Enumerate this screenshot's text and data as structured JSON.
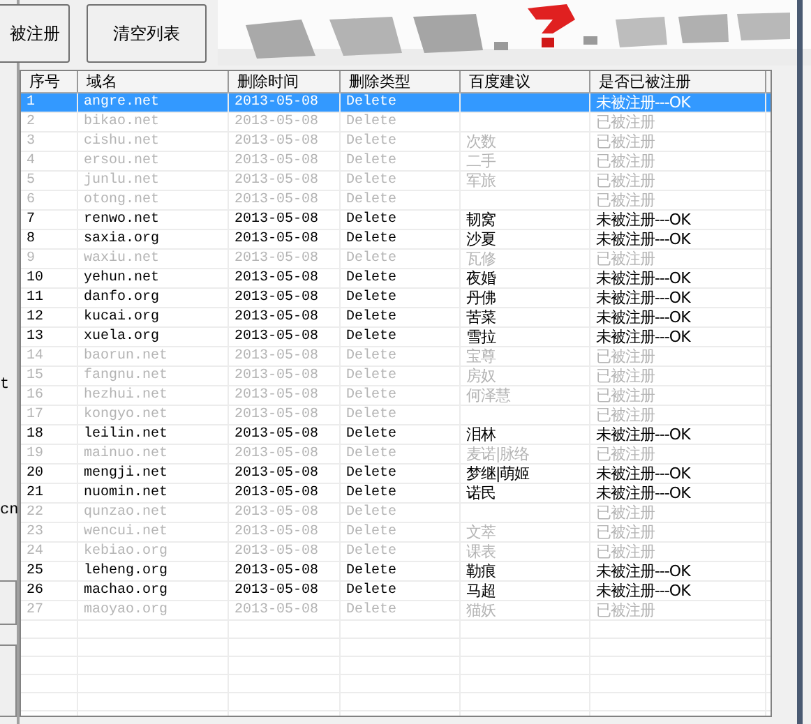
{
  "toolbar": {
    "buttons": [
      "被注册",
      "清空列表"
    ]
  },
  "side_texts": [
    "t",
    "cn"
  ],
  "table": {
    "columns": [
      "序号",
      "域名",
      "删除时间",
      "删除类型",
      "百度建议",
      "是否已被注册"
    ],
    "rows": [
      {
        "cells": [
          "1",
          "angre.net",
          "2013-05-08",
          "Delete",
          "",
          "未被注册---OK"
        ],
        "available": true,
        "selected": true
      },
      {
        "cells": [
          "2",
          "bikao.net",
          "2013-05-08",
          "Delete",
          "",
          "已被注册"
        ],
        "available": false,
        "selected": false
      },
      {
        "cells": [
          "3",
          "cishu.net",
          "2013-05-08",
          "Delete",
          "次数",
          "已被注册"
        ],
        "available": false,
        "selected": false
      },
      {
        "cells": [
          "4",
          "ersou.net",
          "2013-05-08",
          "Delete",
          "二手",
          "已被注册"
        ],
        "available": false,
        "selected": false
      },
      {
        "cells": [
          "5",
          "junlu.net",
          "2013-05-08",
          "Delete",
          "军旅",
          "已被注册"
        ],
        "available": false,
        "selected": false
      },
      {
        "cells": [
          "6",
          "otong.net",
          "2013-05-08",
          "Delete",
          "",
          "已被注册"
        ],
        "available": false,
        "selected": false
      },
      {
        "cells": [
          "7",
          "renwo.net",
          "2013-05-08",
          "Delete",
          "韧窝",
          "未被注册---OK"
        ],
        "available": true,
        "selected": false
      },
      {
        "cells": [
          "8",
          "saxia.org",
          "2013-05-08",
          "Delete",
          "沙夏",
          "未被注册---OK"
        ],
        "available": true,
        "selected": false
      },
      {
        "cells": [
          "9",
          "waxiu.net",
          "2013-05-08",
          "Delete",
          "瓦修",
          "已被注册"
        ],
        "available": false,
        "selected": false
      },
      {
        "cells": [
          "10",
          "yehun.net",
          "2013-05-08",
          "Delete",
          "夜婚",
          "未被注册---OK"
        ],
        "available": true,
        "selected": false
      },
      {
        "cells": [
          "11",
          "danfo.org",
          "2013-05-08",
          "Delete",
          "丹佛",
          "未被注册---OK"
        ],
        "available": true,
        "selected": false
      },
      {
        "cells": [
          "12",
          "kucai.org",
          "2013-05-08",
          "Delete",
          "苦菜",
          "未被注册---OK"
        ],
        "available": true,
        "selected": false
      },
      {
        "cells": [
          "13",
          "xuela.org",
          "2013-05-08",
          "Delete",
          "雪拉",
          "未被注册---OK"
        ],
        "available": true,
        "selected": false
      },
      {
        "cells": [
          "14",
          "baorun.net",
          "2013-05-08",
          "Delete",
          "宝尊",
          "已被注册"
        ],
        "available": false,
        "selected": false
      },
      {
        "cells": [
          "15",
          "fangnu.net",
          "2013-05-08",
          "Delete",
          "房奴",
          "已被注册"
        ],
        "available": false,
        "selected": false
      },
      {
        "cells": [
          "16",
          "hezhui.net",
          "2013-05-08",
          "Delete",
          "何泽慧",
          "已被注册"
        ],
        "available": false,
        "selected": false
      },
      {
        "cells": [
          "17",
          "kongyo.net",
          "2013-05-08",
          "Delete",
          "",
          "已被注册"
        ],
        "available": false,
        "selected": false
      },
      {
        "cells": [
          "18",
          "leilin.net",
          "2013-05-08",
          "Delete",
          "泪林",
          "未被注册---OK"
        ],
        "available": true,
        "selected": false
      },
      {
        "cells": [
          "19",
          "mainuo.net",
          "2013-05-08",
          "Delete",
          "麦诺|脉络",
          "已被注册"
        ],
        "available": false,
        "selected": false
      },
      {
        "cells": [
          "20",
          "mengji.net",
          "2013-05-08",
          "Delete",
          "梦继|萌姬",
          "未被注册---OK"
        ],
        "available": true,
        "selected": false
      },
      {
        "cells": [
          "21",
          "nuomin.net",
          "2013-05-08",
          "Delete",
          "诺民",
          "未被注册---OK"
        ],
        "available": true,
        "selected": false
      },
      {
        "cells": [
          "22",
          "qunzao.net",
          "2013-05-08",
          "Delete",
          "",
          "已被注册"
        ],
        "available": false,
        "selected": false
      },
      {
        "cells": [
          "23",
          "wencui.net",
          "2013-05-08",
          "Delete",
          "文萃",
          "已被注册"
        ],
        "available": false,
        "selected": false
      },
      {
        "cells": [
          "24",
          "kebiao.org",
          "2013-05-08",
          "Delete",
          "课表",
          "已被注册"
        ],
        "available": false,
        "selected": false
      },
      {
        "cells": [
          "25",
          "leheng.org",
          "2013-05-08",
          "Delete",
          "勒痕",
          "未被注册---OK"
        ],
        "available": true,
        "selected": false
      },
      {
        "cells": [
          "26",
          "machao.org",
          "2013-05-08",
          "Delete",
          "马超",
          "未被注册---OK"
        ],
        "available": true,
        "selected": false
      },
      {
        "cells": [
          "27",
          "maoyao.org",
          "2013-05-08",
          "Delete",
          "猫妖",
          "已被注册"
        ],
        "available": false,
        "selected": false
      }
    ]
  }
}
